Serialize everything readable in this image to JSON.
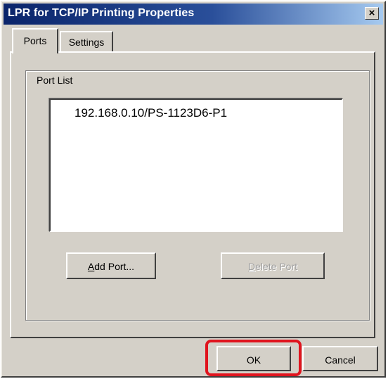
{
  "window": {
    "title": "LPR for TCP/IP Printing Properties",
    "close_glyph": "×"
  },
  "tabs": [
    {
      "label": "Ports",
      "active": true
    },
    {
      "label": "Settings",
      "active": false
    }
  ],
  "port_list": {
    "group_label": "Port List",
    "items": [
      "192.168.0.10/PS-1123D6-P1"
    ]
  },
  "buttons": {
    "add_port": "Add Port...",
    "delete_port": "Delete Port",
    "ok": "OK",
    "cancel": "Cancel"
  },
  "highlight": {
    "color": "#e0141e",
    "target": "ok-button"
  }
}
